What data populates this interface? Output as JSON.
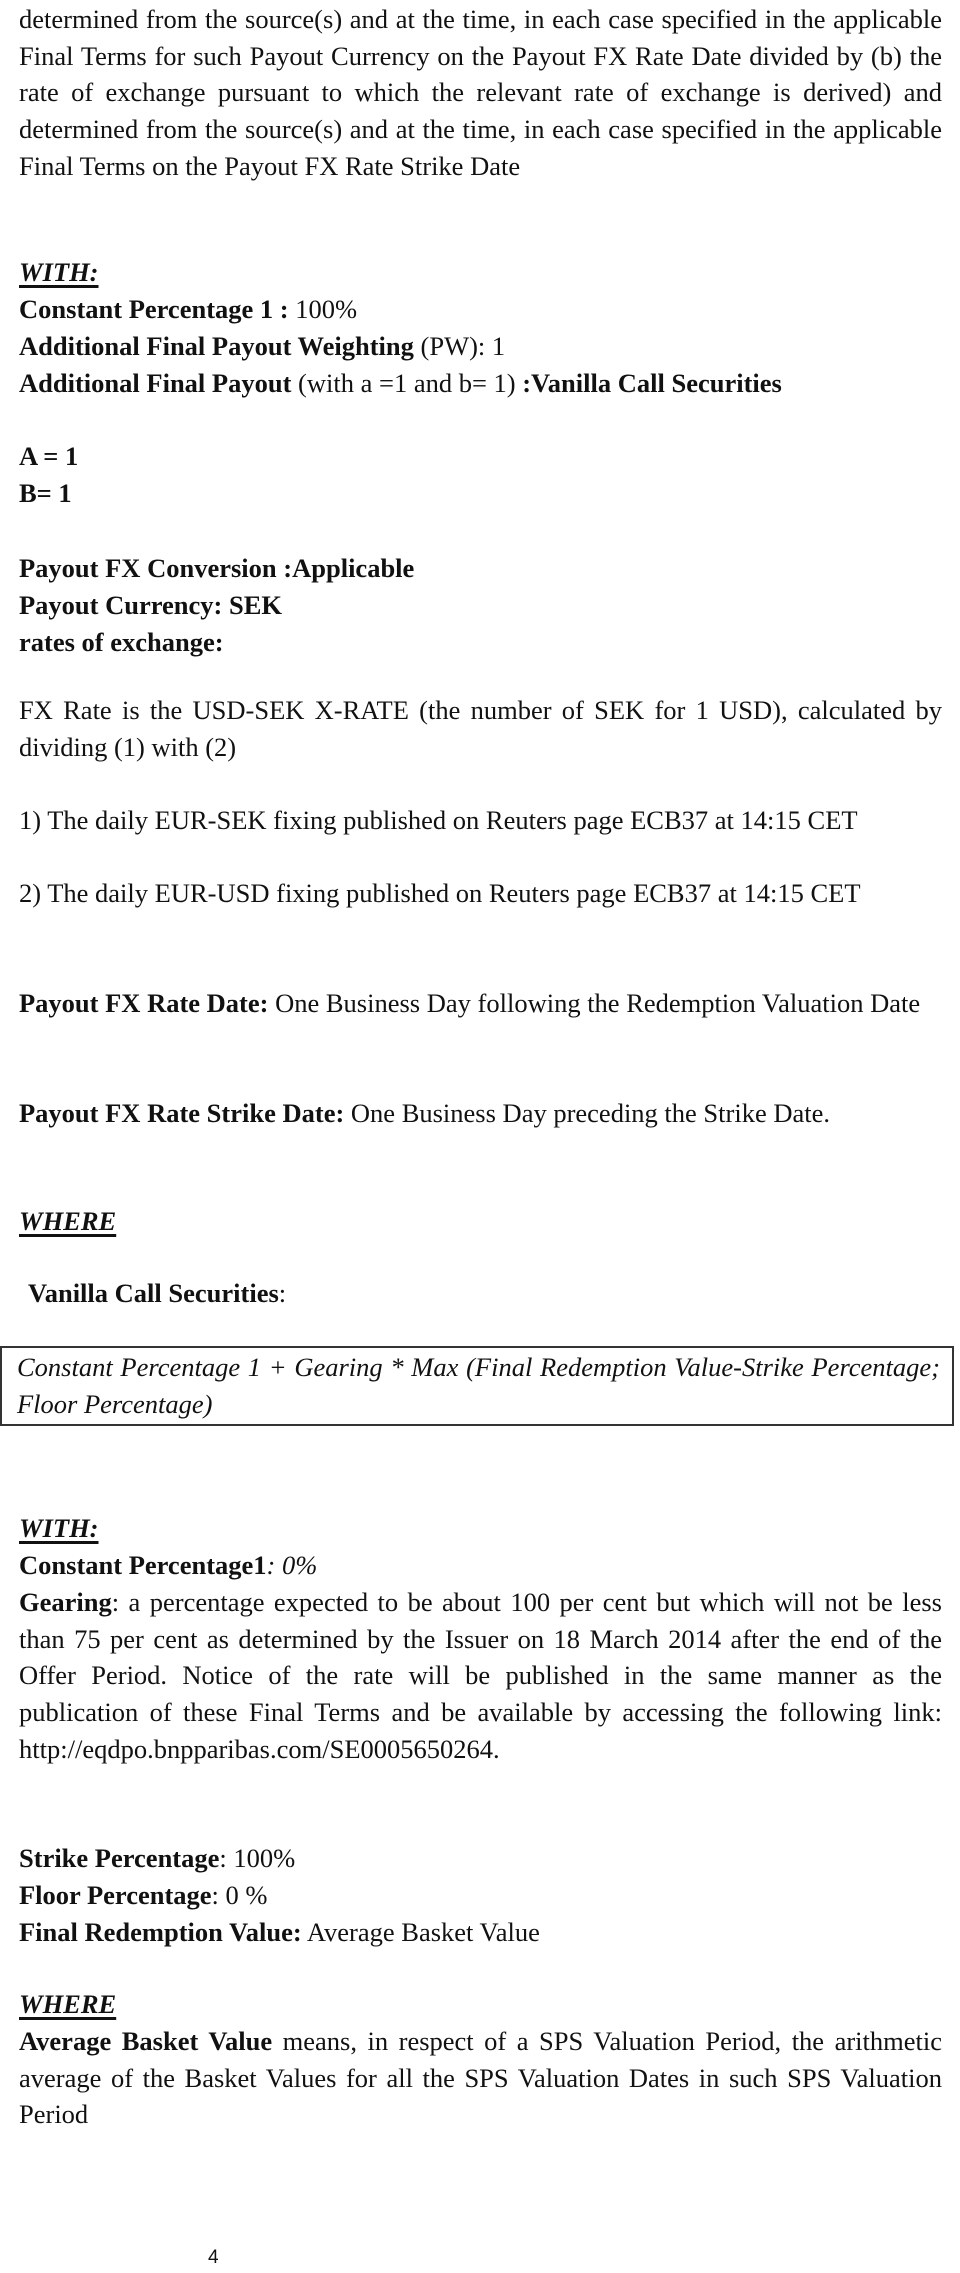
{
  "intro": {
    "lines": "determined from the source(s) and at the time, in each case specified in the applicable Final Terms for such Payout Currency on the Payout FX Rate Date divided by (b) the rate of exchange pursuant to which the relevant rate  of exchange is derived) and determined from the source(s) and at the time, in each case specified  in the applicable Final Terms on the Payout FX Rate Strike Date"
  },
  "with_1": {
    "heading": "WITH:",
    "constant_percentage_1": {
      "label": "Constant Percentage 1 :",
      "value": " 100%"
    },
    "payout_weighting": {
      "label": "Additional Final Payout Weighting",
      "value": " (PW): 1"
    },
    "additional_final_payout": {
      "label": "Additional Final Payout",
      "middle": " (with a =1 and b= 1) ",
      "value": ":Vanilla Call Securities"
    },
    "a": "A = 1",
    "b": "B= 1"
  },
  "fx": {
    "conversion": "Payout FX Conversion :Applicable",
    "currency": "Payout Currency: SEK",
    "rates_heading": "rates of exchange:",
    "fx_rate_desc": "FX Rate is the USD-SEK X-RATE (the number of SEK for 1 USD), calculated  by dividing (1) with (2)",
    "source_1": "1) The daily EUR-SEK fixing published on Reuters page ECB37 at 14:15 CET",
    "source_2": "2) The daily EUR-USD fixing published on Reuters page  ECB37 at 14:15 CET",
    "rate_date": {
      "label": "Payout FX Rate Date:",
      "value": " One Business Day following the Redemption Valuation Date"
    },
    "strike_date": {
      "label": "Payout FX Rate Strike Date:",
      "value": " One Business Day preceding the Strike Date."
    }
  },
  "where_1": {
    "heading": "WHERE",
    "vanilla_label": "Vanilla Call Securities",
    "vanilla_colon": ":",
    "formula": "Constant Percentage 1 + Gearing * Max (Final Redemption Value-Strike Percentage; Floor Percentage)"
  },
  "with_2": {
    "heading": "WITH:",
    "constant_percentage_1": {
      "label": "Constant Percentage1",
      "value": ": 0%"
    },
    "gearing": {
      "label": "Gearing",
      "value": ": a percentage expected to be about 100 per cent but which will not be less than 75 per cent as determined by the Issuer on 18 March 2014 after the end of the Offer Period. Notice of the rate will be published in the same manner as the publication of these Final Terms and be available by accessing the following link: http://eqdpo.bnpparibas.com/SE0005650264."
    },
    "strike_percentage": {
      "label": "Strike Percentage",
      "value": ": 100%"
    },
    "floor_percentage": {
      "label": "Floor Percentage",
      "value": ": 0 %"
    },
    "final_redemption_value": {
      "label": "Final Redemption Value:",
      "value": " Average Basket Value"
    }
  },
  "where_2": {
    "heading": "WHERE",
    "average_basket_value": {
      "label": "Average Basket Value",
      "value": " means, in respect of a SPS Valuation Period, the arithmetic average of the Basket Values for all the SPS Valuation Dates in such SPS Valuation Period"
    }
  },
  "footer": {
    "page_number": "4"
  }
}
